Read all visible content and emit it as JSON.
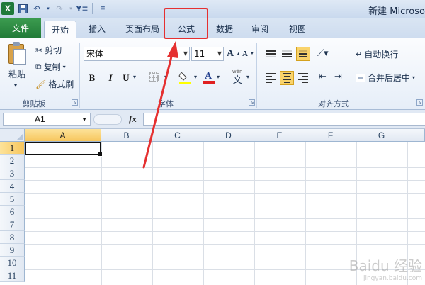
{
  "title_bar": {
    "window_title": "新建 Microso",
    "app_logo": "X"
  },
  "tabs": [
    {
      "label": "文件"
    },
    {
      "label": "开始"
    },
    {
      "label": "插入"
    },
    {
      "label": "页面布局"
    },
    {
      "label": "公式"
    },
    {
      "label": "数据"
    },
    {
      "label": "审阅"
    },
    {
      "label": "视图"
    }
  ],
  "active_tab": "开始",
  "highlighted_tab": "公式",
  "clipboard": {
    "paste": "粘贴",
    "cut": "剪切",
    "copy": "复制",
    "format_painter": "格式刷",
    "group_label": "剪贴板"
  },
  "font": {
    "font_name": "宋体",
    "font_size": "11",
    "bold": "B",
    "italic": "I",
    "underline": "U",
    "group_label": "字体"
  },
  "alignment": {
    "wrap_text": "自动换行",
    "merge_center": "合并后居中",
    "group_label": "对齐方式"
  },
  "formula_bar": {
    "name_box": "A1",
    "fx": "fx",
    "formula": ""
  },
  "sheet": {
    "columns": [
      "A",
      "B",
      "C",
      "D",
      "E",
      "F",
      "G"
    ],
    "rows": [
      "1",
      "2",
      "3",
      "4",
      "5",
      "6",
      "7",
      "8",
      "9",
      "10",
      "11"
    ],
    "selected_cell": "A1"
  },
  "watermark": {
    "text": "Baidu 经验",
    "sub": "jingyan.baidu.com"
  },
  "colors": {
    "file_tab": "#217a37",
    "highlight": "#e53030",
    "selected_header": "#f7c65d"
  }
}
